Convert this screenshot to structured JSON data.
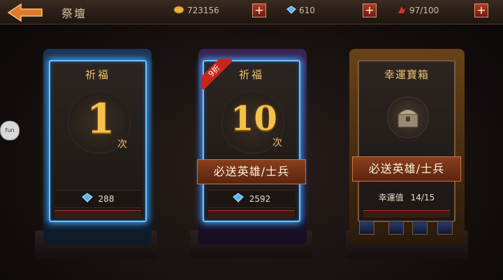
{
  "header": {
    "title": "祭壇",
    "gold": "723156",
    "gems": "610",
    "stamina": "97/100"
  },
  "side_widget": {
    "label": "fun"
  },
  "cards": [
    {
      "title": "祈福",
      "count": "1",
      "unit": "次",
      "cost": "288"
    },
    {
      "title": "祈福",
      "count": "10",
      "unit": "次",
      "discount": "9折",
      "banner": "必送英雄/士兵",
      "cost": "2592"
    },
    {
      "title": "幸運寶箱",
      "banner": "必送英雄/士兵",
      "luck_label": "幸運值",
      "luck_value": "14/15"
    }
  ],
  "colors": {
    "accent_gold": "#f4c24a",
    "glow_blue": "#3aa6ff",
    "ribbon_red": "#c8261c"
  }
}
